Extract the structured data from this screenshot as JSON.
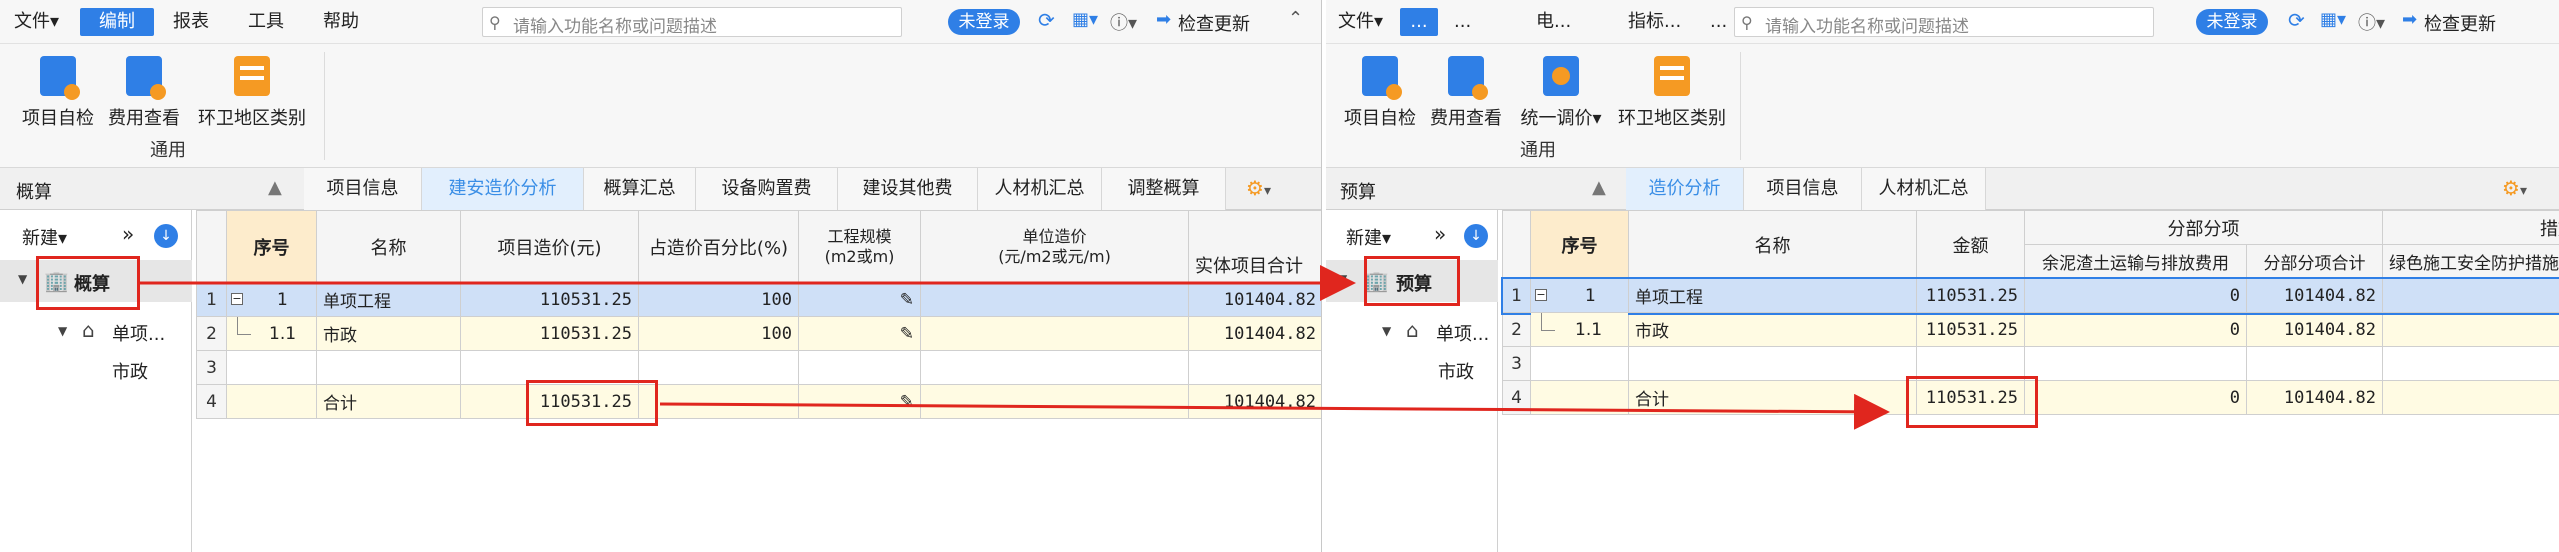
{
  "left": {
    "menu": [
      {
        "label": "文件▾",
        "active": false
      },
      {
        "label": "编制",
        "active": true
      },
      {
        "label": "报表",
        "active": false
      },
      {
        "label": "工具",
        "active": false
      },
      {
        "label": "帮助",
        "active": false
      }
    ],
    "search_placeholder": "请输入功能名称或问题描述",
    "login_label": "未登录",
    "update_label": "检查更新",
    "ribbon": {
      "buttons": [
        "项目自检",
        "费用查看",
        "环卫地区类别"
      ],
      "group_label": "通用"
    },
    "panel_title": "概算",
    "tabs": [
      "项目信息",
      "建安造价分析",
      "概算汇总",
      "设备购置费",
      "建设其他费",
      "人材机汇总",
      "调整概算"
    ],
    "active_tab": "建安造价分析",
    "nav": {
      "new_label": "新建▾",
      "expand_label": "»",
      "root": "概算",
      "child": "单项...",
      "leaf": "市政"
    },
    "table": {
      "headers": [
        "序号",
        "名称",
        "项目造价(元)",
        "占造价百分比(%)",
        "工程规模\n(m2或m)",
        "单位造价\n(元/m2或元/m)",
        "实体项目合计"
      ],
      "rows": [
        {
          "rn": "1",
          "seq": "1",
          "name": "单项工程",
          "cost": "110531.25",
          "pct": "100",
          "entity": "101404.82"
        },
        {
          "rn": "2",
          "seq": "1.1",
          "name": "市政",
          "cost": "110531.25",
          "pct": "100",
          "entity": "101404.82"
        },
        {
          "rn": "3",
          "seq": "",
          "name": "",
          "cost": "",
          "pct": "",
          "entity": ""
        },
        {
          "rn": "4",
          "seq": "",
          "name": "合计",
          "cost": "110531.25",
          "pct": "",
          "entity": "101404.82"
        }
      ]
    }
  },
  "right": {
    "menu": [
      {
        "label": "文件▾",
        "active": false
      },
      {
        "label": "...",
        "active": true
      },
      {
        "label": "...",
        "active": false
      },
      {
        "label": "电...",
        "active": false
      },
      {
        "label": "指标...",
        "active": false
      },
      {
        "label": "...",
        "active": false
      }
    ],
    "search_placeholder": "请输入功能名称或问题描述",
    "login_label": "未登录",
    "update_label": "检查更新",
    "ribbon": {
      "buttons": [
        "项目自检",
        "费用查看",
        "统一调价▾",
        "环卫地区类别"
      ],
      "group_label": "通用"
    },
    "panel_title": "预算",
    "tabs": [
      "造价分析",
      "项目信息",
      "人材机汇总"
    ],
    "active_tab": "造价分析",
    "nav": {
      "new_label": "新建▾",
      "expand_label": "»",
      "root": "预算",
      "child": "单项...",
      "leaf": "市政"
    },
    "table": {
      "group_header_1": "分部分项",
      "group_header_2": "措施",
      "headers": [
        "序号",
        "名称",
        "金额",
        "余泥渣土运输与排放费用",
        "分部分项合计",
        "绿色施工安全防护措施"
      ],
      "rows": [
        {
          "rn": "1",
          "seq": "1",
          "name": "单项工程",
          "amount": "110531.25",
          "mud": "0",
          "subtotal": "101404.82"
        },
        {
          "rn": "2",
          "seq": "1.1",
          "name": "市政",
          "amount": "110531.25",
          "mud": "0",
          "subtotal": "101404.82"
        },
        {
          "rn": "3",
          "seq": "",
          "name": "",
          "amount": "",
          "mud": "",
          "subtotal": ""
        },
        {
          "rn": "4",
          "seq": "",
          "name": "合计",
          "amount": "110531.25",
          "mud": "0",
          "subtotal": "101404.82"
        }
      ]
    }
  },
  "colors": {
    "accent": "#2f7fe6",
    "active_tab_bg": "#e2effd",
    "selected_row": "#cfe0f7",
    "seq_header": "#fdeccc",
    "highlight": "#e0261e"
  }
}
